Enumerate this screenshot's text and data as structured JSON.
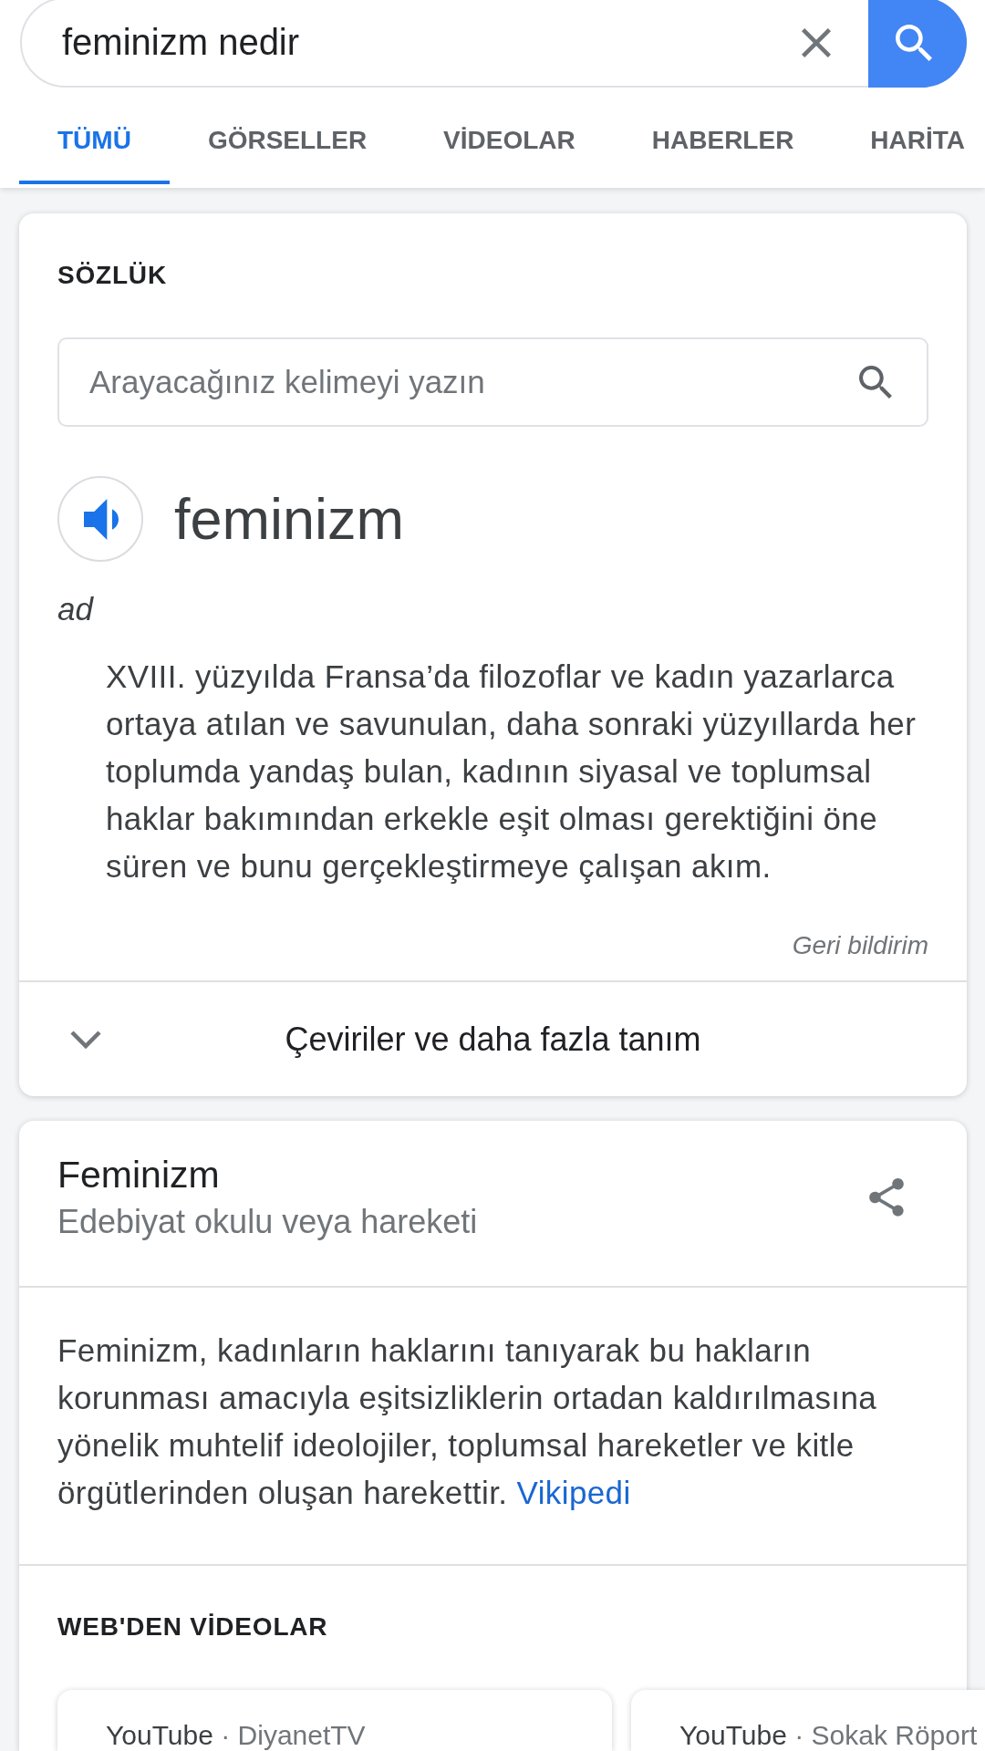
{
  "search_bar": {
    "query": "feminizm nedir"
  },
  "tabs": [
    {
      "label": "TÜMÜ",
      "selected": true
    },
    {
      "label": "GÖRSELLER",
      "selected": false
    },
    {
      "label": "VİDEOLAR",
      "selected": false
    },
    {
      "label": "HABERLER",
      "selected": false
    },
    {
      "label": "HARİTA",
      "selected": false
    }
  ],
  "dictionary": {
    "heading": "SÖZLÜK",
    "search": {
      "placeholder": "Arayacağınız kelimeyi yazın"
    },
    "word": "feminizm",
    "part_of_speech": "ad",
    "definition": "XVIII. yüzyılda Fransa’da filozoflar ve kadın yazarlarca ortaya atılan ve savunulan, daha sonraki yüzyıllarda her toplumda yandaş bulan, kadının siyasal ve toplumsal haklar bakımından erkekle eşit olması gerektiğini öne süren ve bunu gerçekleştirmeye çalışan akım.",
    "feedback": "Geri bildirim",
    "more_button": "Çeviriler ve daha fazla tanım"
  },
  "knowledge_panel": {
    "title": "Feminizm",
    "subtitle": "Edebiyat okulu veya hareketi",
    "description": "Feminizm, kadınların haklarını tanıyarak bu hakların korunması amacıyla eşitsizliklerin ortadan kaldırılmasına yönelik muhtelif ideolojiler, toplumsal hareketler ve kitle örgütlerinden oluşan harekettir.",
    "source_link": "Vikipedi",
    "videos_heading": "WEB'DEN VİDEOLAR",
    "videos": [
      {
        "site": "YouTube",
        "channel": "· DiyanetTV"
      },
      {
        "site": "YouTube",
        "channel": "· Sokak Röport"
      }
    ]
  }
}
